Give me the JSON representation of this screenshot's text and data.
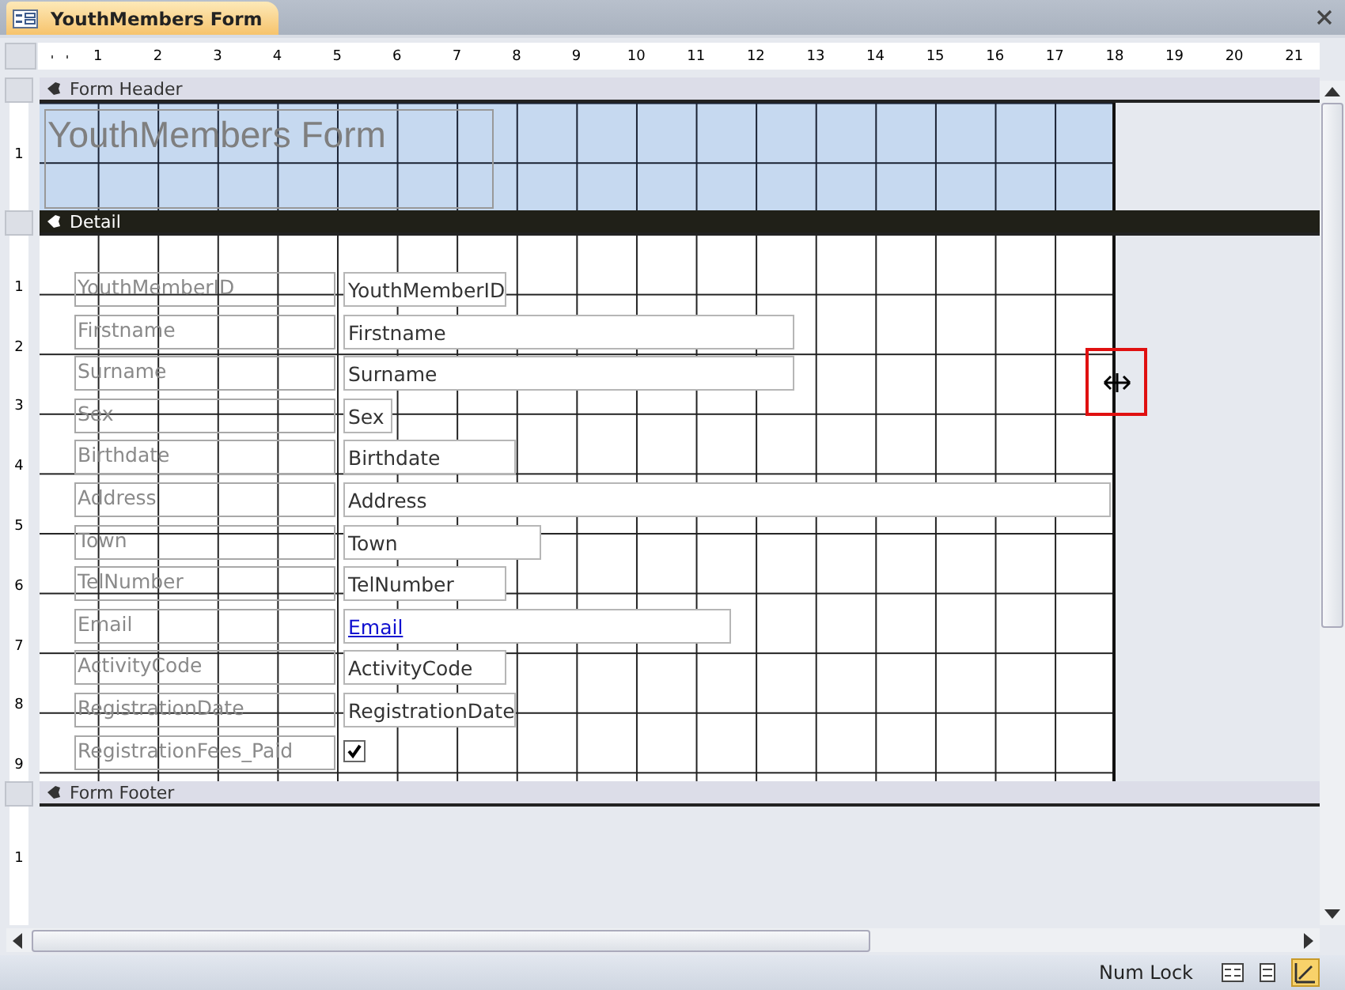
{
  "tab": {
    "title": "YouthMembers Form",
    "selected": true
  },
  "ruler": [
    "1",
    "2",
    "3",
    "4",
    "5",
    "6",
    "7",
    "8",
    "9",
    "10",
    "11",
    "12",
    "13",
    "14",
    "15",
    "16",
    "17",
    "18",
    "19",
    "20",
    "21"
  ],
  "sections": [
    {
      "kind": "header",
      "title": "Form Header",
      "selected": false,
      "ruler_marks": [
        "1"
      ]
    },
    {
      "kind": "detail",
      "title": "Detail",
      "selected": true,
      "ruler_marks": [
        "1",
        "2",
        "3",
        "4",
        "5",
        "6",
        "7",
        "8",
        "9"
      ]
    },
    {
      "kind": "footer",
      "title": "Form Footer",
      "selected": false,
      "ruler_marks": [
        "1"
      ]
    }
  ],
  "form_title": "YouthMembers Form",
  "controls": [
    {
      "label": "YouthMemberID",
      "kind": "textbox",
      "value": "YouthMemberID"
    },
    {
      "label": "Firstname",
      "kind": "textbox",
      "value": "Firstname"
    },
    {
      "label": "Surname",
      "kind": "textbox",
      "value": "Surname"
    },
    {
      "label": "Sex",
      "kind": "textbox",
      "value": "Sex"
    },
    {
      "label": "Birthdate",
      "kind": "textbox",
      "value": "Birthdate"
    },
    {
      "label": "Address",
      "kind": "textbox",
      "value": "Address"
    },
    {
      "label": "Town",
      "kind": "textbox",
      "value": "Town"
    },
    {
      "label": "TelNumber",
      "kind": "textbox",
      "value": "TelNumber"
    },
    {
      "label": "Email",
      "kind": "hyperlink",
      "value": "Email"
    },
    {
      "label": "ActivityCode",
      "kind": "textbox",
      "value": "ActivityCode"
    },
    {
      "label": "RegistrationDate",
      "kind": "textbox",
      "value": "RegistrationDate"
    },
    {
      "label": "RegistrationFees_Paid",
      "kind": "checkbox",
      "checked": true
    }
  ],
  "status_bar": {
    "indicator": "Num Lock"
  }
}
